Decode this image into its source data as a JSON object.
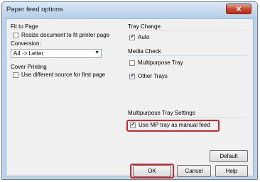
{
  "window": {
    "title": "Paper feed options",
    "close_glyph": "✕"
  },
  "fit_to_page": {
    "heading": "Fit to Page",
    "resize_label": "Resize document to fit printer page",
    "resize_checked": false,
    "conversion_label": "Conversion:",
    "conversion_value": "A4 -> Letter",
    "dropdown_arrow": "▼"
  },
  "cover_printing": {
    "heading": "Cover Printing",
    "different_source_label": "Use different source for first page",
    "different_source_checked": false
  },
  "tray_change": {
    "heading": "Tray Change",
    "auto_label": "Auto",
    "auto_checked": true
  },
  "media_check": {
    "heading": "Media Check",
    "multipurpose_label": "Multipurpose Tray",
    "multipurpose_checked": false,
    "other_label": "Other Trays",
    "other_checked": true
  },
  "mp_settings": {
    "heading": "Multipurpose Tray Settings",
    "manual_feed_label": "Use MP tray as manual feed",
    "manual_feed_checked": true
  },
  "buttons": {
    "default": "Default",
    "ok": "OK",
    "cancel": "Cancel",
    "help": "Help"
  },
  "colors": {
    "highlight": "#d0252a",
    "close_button": "#c8452b",
    "frame": "#bcd3ea"
  }
}
